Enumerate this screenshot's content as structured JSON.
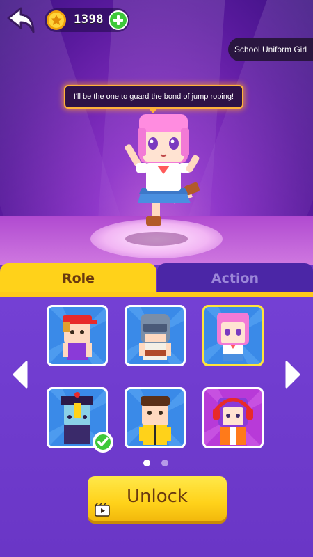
{
  "header": {
    "coins": "1398",
    "icons": {
      "back": "back-arrow-icon",
      "coin": "star-coin-icon",
      "add": "plus-icon"
    }
  },
  "character": {
    "name": "School Uniform Girl",
    "quote": "I'll be the one to guard the bond of jump roping!"
  },
  "tabs": [
    {
      "label": "Role",
      "active": true
    },
    {
      "label": "Action",
      "active": false
    }
  ],
  "roles": [
    {
      "id": "red-cap-kid",
      "selected": false,
      "owned": false
    },
    {
      "id": "helmet-soldier",
      "selected": false,
      "owned": false
    },
    {
      "id": "school-uniform-girl",
      "selected": true,
      "owned": false
    },
    {
      "id": "jiangshi",
      "selected": false,
      "owned": true
    },
    {
      "id": "yellow-tracksuit",
      "selected": false,
      "owned": false
    },
    {
      "id": "headphone-girl",
      "selected": false,
      "owned": false
    }
  ],
  "pagination": {
    "current": 1,
    "total": 2
  },
  "actions": {
    "unlock_label": "Unlock"
  },
  "colors": {
    "tab_active": "#ffd21a",
    "tab_inactive": "#4b26a6",
    "panel": "#7440d4",
    "selected_border": "#ffe43a"
  }
}
